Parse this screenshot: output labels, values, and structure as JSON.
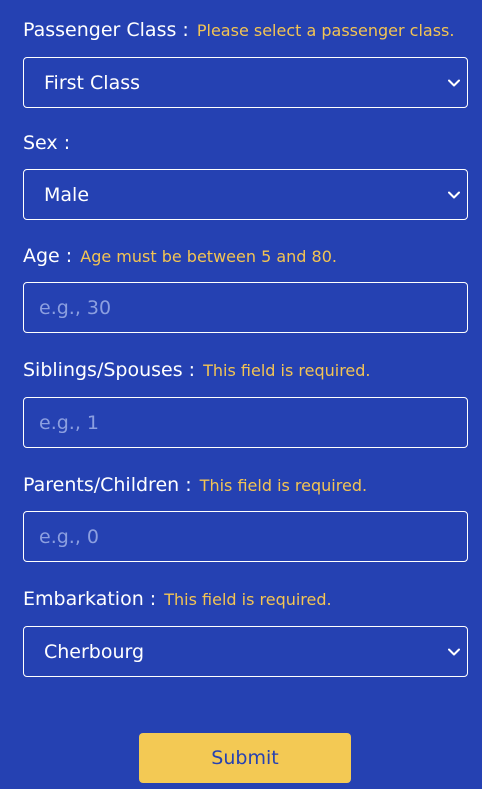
{
  "fields": {
    "pclass": {
      "label": "Passenger Class :",
      "error": "Please select a passenger class.",
      "value": "First Class"
    },
    "sex": {
      "label": "Sex :",
      "value": "Male"
    },
    "age": {
      "label": "Age :",
      "error": "Age must be between 5 and 80.",
      "placeholder": "e.g., 30"
    },
    "sibsp": {
      "label": "Siblings/Spouses :",
      "error": "This field is required.",
      "placeholder": "e.g., 1"
    },
    "parch": {
      "label": "Parents/Children :",
      "error": "This field is required.",
      "placeholder": "e.g., 0"
    },
    "embarked": {
      "label": "Embarkation :",
      "error": "This field is required.",
      "value": "Cherbourg"
    }
  },
  "submit_label": "Submit",
  "colors": {
    "background": "#2541b2",
    "error_text": "#f3c453",
    "button": "#f3c954",
    "placeholder": "#8c9fe0"
  },
  "icons": {
    "select_arrow": "chevron-down-icon"
  }
}
